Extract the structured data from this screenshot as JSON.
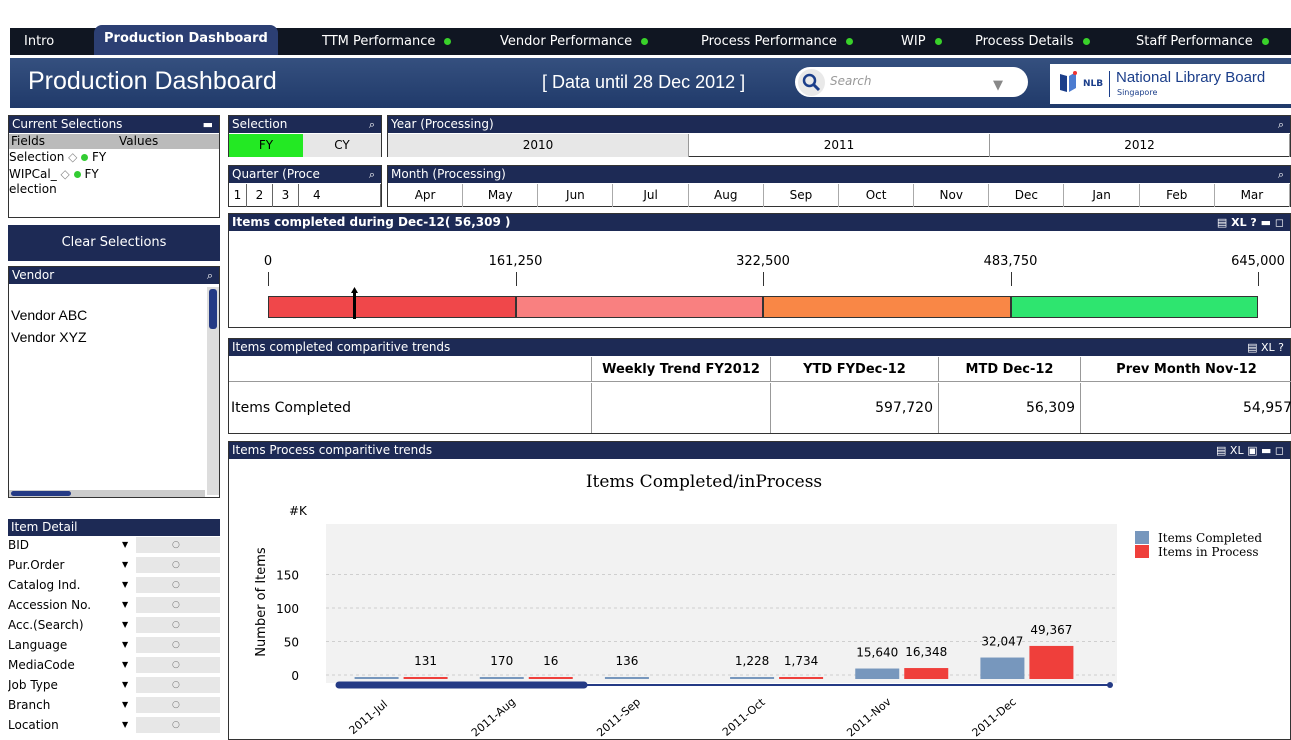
{
  "tabs": [
    {
      "label": "Intro",
      "dot": false
    },
    {
      "label": "Production Dashboard",
      "dot": false,
      "active": true
    },
    {
      "label": "TTM Performance",
      "dot": true
    },
    {
      "label": "Vendor Performance",
      "dot": true
    },
    {
      "label": "Process Performance",
      "dot": true
    },
    {
      "label": "WIP",
      "dot": true
    },
    {
      "label": "Process Details",
      "dot": true
    },
    {
      "label": "Staff Performance",
      "dot": true
    }
  ],
  "header": {
    "title": "Production Dashboard",
    "data_info": "[ Data until 28 Dec 2012 ]",
    "search_placeholder": "Search",
    "logo_abbr": "NLB",
    "logo_name": "National Library Board",
    "logo_sub": "Singapore"
  },
  "current_selections": {
    "title": "Current Selections",
    "col_fields": "Fields",
    "col_values": "Values",
    "rows": [
      {
        "field": "Selection",
        "value": "FY"
      },
      {
        "field": "WIPCal_",
        "field2": "election",
        "value": "FY"
      }
    ]
  },
  "clear_label": "Clear Selections",
  "vendor": {
    "title": "Vendor",
    "items": [
      "Vendor ABC",
      "Vendor XYZ"
    ]
  },
  "item_detail": {
    "title": "Item Detail",
    "rows": [
      "BID",
      "Pur.Order",
      "Catalog Ind.",
      "Accession No.",
      "Acc.(Search)",
      "Language",
      "MediaCode",
      "Job Type",
      "Branch",
      "Location"
    ]
  },
  "selection_box": {
    "title": "Selection",
    "fy": "FY",
    "cy": "CY"
  },
  "year_box": {
    "title": "Year (Processing)",
    "years": [
      "2010",
      "2011",
      "2012"
    ]
  },
  "quarter_box": {
    "title": "Quarter (Proce",
    "quarters": [
      "1",
      "2",
      "3",
      "4"
    ]
  },
  "month_box": {
    "title": "Month (Processing)",
    "months": [
      "Apr",
      "May",
      "Jun",
      "Jul",
      "Aug",
      "Sep",
      "Oct",
      "Nov",
      "Dec",
      "Jan",
      "Feb",
      "Mar"
    ]
  },
  "gauge": {
    "title": "Items completed during Dec-12( 56,309 )",
    "ticks": [
      "0",
      "161,250",
      "322,500",
      "483,750",
      "645,000"
    ],
    "min": 0,
    "max": 645000,
    "value": 56309,
    "segment_colors": [
      "#f0474a",
      "#f98080",
      "#f98746",
      "#2ee56f"
    ]
  },
  "trend_table": {
    "title": "Items completed comparitive trends",
    "headers": [
      "",
      "Weekly Trend FY2012",
      "YTD FYDec-12",
      "MTD Dec-12",
      "Prev Month Nov-12"
    ],
    "row": [
      "Items Completed",
      "",
      "597,720",
      "56,309",
      "54,957"
    ]
  },
  "process_chart": {
    "panel_title": "Items Process comparitive trends",
    "toolbar_icons": [
      "XL"
    ]
  },
  "chart_data": {
    "type": "bar",
    "title": "Items Completed/inProcess",
    "unit_label": "#K",
    "ylabel": "Number of Items",
    "yticks": [
      "0",
      "50",
      "100",
      "150"
    ],
    "ylim": [
      0,
      190
    ],
    "categories": [
      "2011-Jul",
      "2011-Aug",
      "2011-Sep",
      "2011-Oct",
      "2011-Nov",
      "2011-Dec"
    ],
    "series": [
      {
        "name": "Items Completed",
        "color": "#7797bd",
        "values": [
          0,
          170,
          136,
          1228,
          15640,
          32047
        ],
        "labels": [
          "",
          "170",
          "136",
          "1,228",
          "15,640",
          "32,047"
        ]
      },
      {
        "name": "Items in Process",
        "color": "#ef3f3b",
        "values": [
          131,
          16,
          null,
          1734,
          16348,
          49367
        ],
        "labels": [
          "131",
          "16",
          "",
          "1,734",
          "16,348",
          "49,367"
        ]
      }
    ],
    "grid": true,
    "legend": "right"
  }
}
